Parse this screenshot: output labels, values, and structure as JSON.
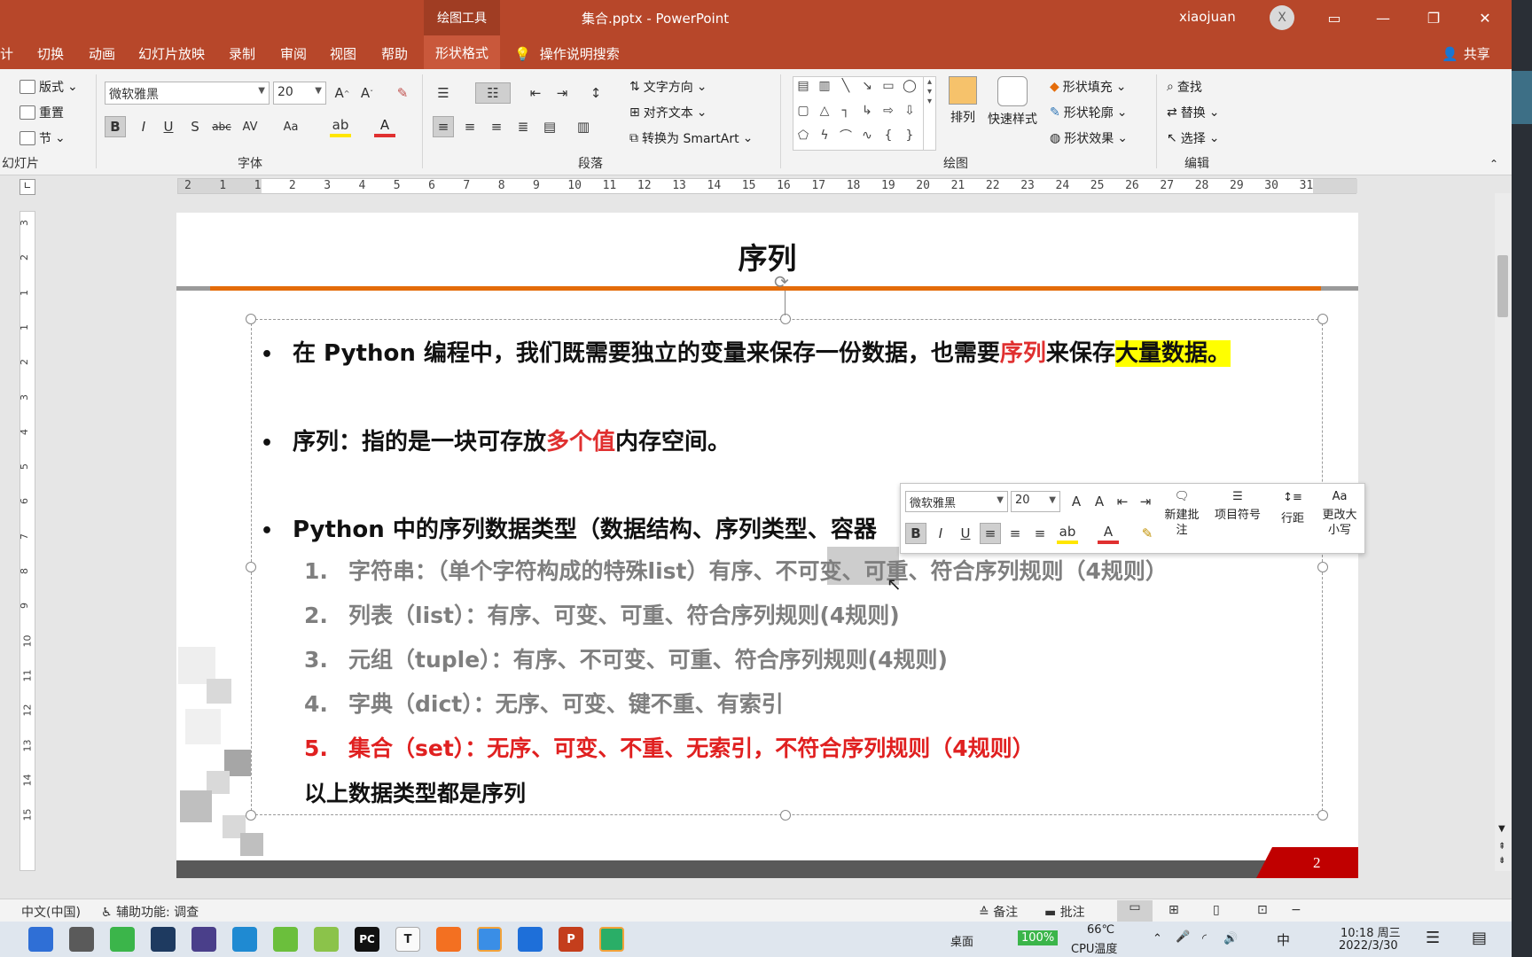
{
  "titlebar": {
    "context_tab": "绘图工具",
    "doc_title": "集合.pptx - PowerPoint",
    "user": "xiaojuan",
    "avatar": "X"
  },
  "tabs": [
    "计",
    "切换",
    "动画",
    "幻灯片放映",
    "录制",
    "审阅",
    "视图",
    "帮助"
  ],
  "active_tab": "形状格式",
  "tell_me": "操作说明搜索",
  "share": "共享",
  "ribbon": {
    "slides": {
      "layout": "版式",
      "reset": "重置",
      "section": "节",
      "label": "幻灯片"
    },
    "font": {
      "name": "微软雅黑",
      "size": "20",
      "label": "字体"
    },
    "paragraph": {
      "text_direction": "文字方向",
      "align_text": "对齐文本",
      "smartart": "转换为 SmartArt",
      "label": "段落"
    },
    "drawing": {
      "arrange": "排列",
      "quick_styles": "快速样式",
      "fill": "形状填充",
      "outline": "形状轮廓",
      "effects": "形状效果",
      "label": "绘图"
    },
    "editing": {
      "find": "查找",
      "replace": "替换",
      "select": "选择",
      "label": "编辑"
    }
  },
  "slide": {
    "title": "序列",
    "b1": {
      "a": "在 Python 编程中，我们既需要独立的变量来保存一份数据，也需要",
      "b": "序列",
      "c": "来保存",
      "d": "大量数据。"
    },
    "b2": {
      "a": "序列：指的是一块可存放",
      "b": "多个值",
      "c": "内存空间。"
    },
    "b3": "Python 中的序列数据类型（数据结构、序列类型、容器",
    "items": [
      {
        "n": "1.",
        "text": "字符串：（单个字符构成的特殊list）有序、不可变、可重、符合序列规则（4规则）"
      },
      {
        "n": "2.",
        "text": "列表（list）：有序、可变、可重、符合序列规则(4规则)"
      },
      {
        "n": "3.",
        "text": "元组（tuple）：有序、不可变、可重、符合序列规则(4规则)"
      },
      {
        "n": "4.",
        "text": "字典（dict）：无序、可变、键不重、有索引"
      },
      {
        "n": "5.",
        "text": "集合（set）：无序、可变、不重、无索引，不符合序列规则（4规则）"
      }
    ],
    "summary": "以上数据类型都是序列",
    "page": "2"
  },
  "minitoolbar": {
    "font": "微软雅黑",
    "size": "20",
    "new_comment": "新建批注",
    "bullets": "项目符号",
    "line_spacing": "行距",
    "change_case": "更改大小写"
  },
  "status": {
    "language": "中文(中国)",
    "accessibility": "辅助功能: 调查",
    "notes": "备注",
    "comments": "批注"
  },
  "taskbar": {
    "desktop": "桌面",
    "battery": "100%",
    "temp": "66℃",
    "cpu": "CPU温度",
    "time": "10:18 周三",
    "date": "2022/3/30",
    "ime": "中"
  }
}
